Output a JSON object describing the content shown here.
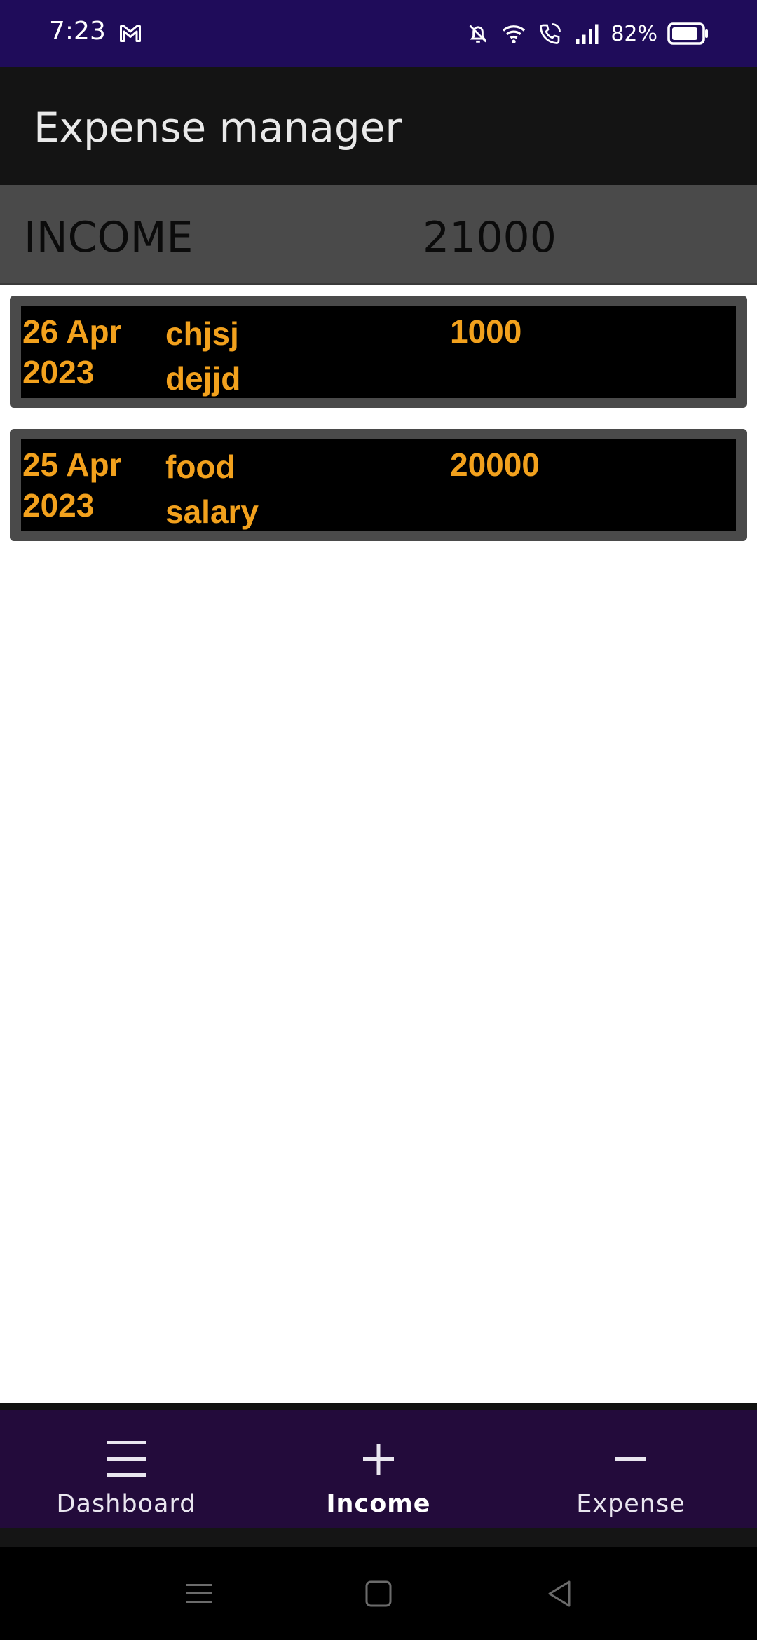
{
  "status_bar": {
    "time": "7:23",
    "battery_percent": "82%",
    "icons": [
      "mail-icon",
      "bell-off-icon",
      "wifi-icon",
      "wifi-calling-icon",
      "signal-icon",
      "battery-icon"
    ]
  },
  "app_bar": {
    "title": "Expense manager"
  },
  "summary": {
    "label": "INCOME",
    "total": "21000"
  },
  "entries": [
    {
      "date_line1": "26 Apr",
      "date_line2": "2023",
      "desc_line1": "chjsj",
      "desc_line2": "dejjd",
      "amount": "1000"
    },
    {
      "date_line1": "25 Apr",
      "date_line2": "2023",
      "desc_line1": "food",
      "desc_line2": "salary",
      "amount": "20000"
    }
  ],
  "bottom_nav": {
    "items": [
      {
        "label": "Dashboard",
        "icon": "menu-icon",
        "active": false
      },
      {
        "label": "Income",
        "icon": "plus-icon",
        "active": true
      },
      {
        "label": "Expense",
        "icon": "minus-icon",
        "active": false
      }
    ]
  },
  "colors": {
    "status_bar": "#1f0c5a",
    "app_bar": "#141414",
    "accent_text": "#f2a11d",
    "bottom_nav": "#230b3b"
  }
}
